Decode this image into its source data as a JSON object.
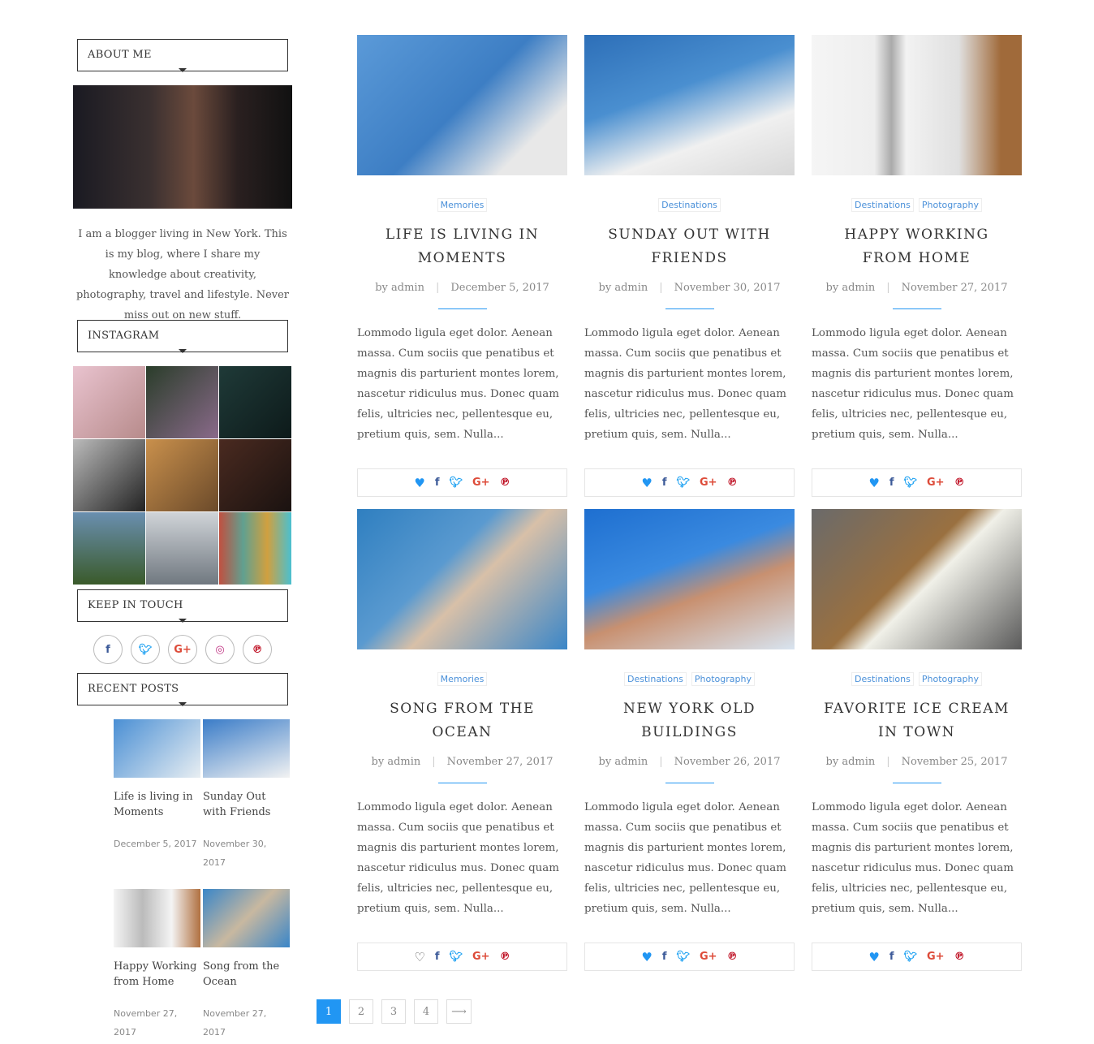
{
  "sidebar": {
    "about": {
      "heading": "ABOUT ME",
      "text": "I am a blogger living in New York. This is my blog, where I share my knowledge about creativity, photography, travel and lifestyle. Never miss out on new stuff."
    },
    "instagram": {
      "heading": "INSTAGRAM"
    },
    "keep_in_touch": {
      "heading": "KEEP IN TOUCH",
      "icons": [
        "facebook-icon",
        "twitter-icon",
        "google-plus-icon",
        "instagram-icon",
        "pinterest-icon"
      ]
    },
    "recent_posts": {
      "heading": "RECENT POSTS",
      "items": [
        {
          "title": "Life is living in Moments",
          "date": "December 5, 2017"
        },
        {
          "title": "Sunday Out with Friends",
          "date": "November 30, 2017"
        },
        {
          "title": "Happy Working from Home",
          "date": "November 27, 2017"
        },
        {
          "title": "Song from the Ocean",
          "date": "November 27, 2017"
        }
      ]
    }
  },
  "posts": [
    {
      "tags": [
        "Memories"
      ],
      "title": "LIFE IS LIVING IN MOMENTS",
      "by": "by admin",
      "date": "December 5, 2017",
      "liked": true
    },
    {
      "tags": [
        "Destinations"
      ],
      "title": "SUNDAY OUT WITH FRIENDS",
      "by": "by admin",
      "date": "November 30, 2017",
      "liked": true
    },
    {
      "tags": [
        "Destinations",
        "Photography"
      ],
      "title": "HAPPY WORKING FROM HOME",
      "by": "by admin",
      "date": "November 27, 2017",
      "liked": true
    },
    {
      "tags": [
        "Memories"
      ],
      "title": "SONG FROM THE OCEAN",
      "by": "by admin",
      "date": "November 27, 2017",
      "liked": false
    },
    {
      "tags": [
        "Destinations",
        "Photography"
      ],
      "title": "NEW YORK OLD BUILDINGS",
      "by": "by admin",
      "date": "November 26, 2017",
      "liked": true
    },
    {
      "tags": [
        "Destinations",
        "Photography"
      ],
      "title": "FAVORITE ICE CREAM IN TOWN",
      "by": "by admin",
      "date": "November 25, 2017",
      "liked": true
    }
  ],
  "excerpt": "Lommodo ligula eget dolor. Aenean massa. Cum sociis que penatibus et magnis dis parturient montes lorem, nascetur ridiculus mus. Donec quam felis, ultricies nec, pellentesque eu, pretium quis, sem. Nulla...",
  "pagination": {
    "pages": [
      "1",
      "2",
      "3",
      "4"
    ],
    "current": "1",
    "next": "⟶"
  },
  "colors": {
    "accent": "#2196f3",
    "facebook": "#3b5998",
    "twitter": "#1da1f2",
    "google": "#dd4b39",
    "pinterest": "#bd081c"
  }
}
